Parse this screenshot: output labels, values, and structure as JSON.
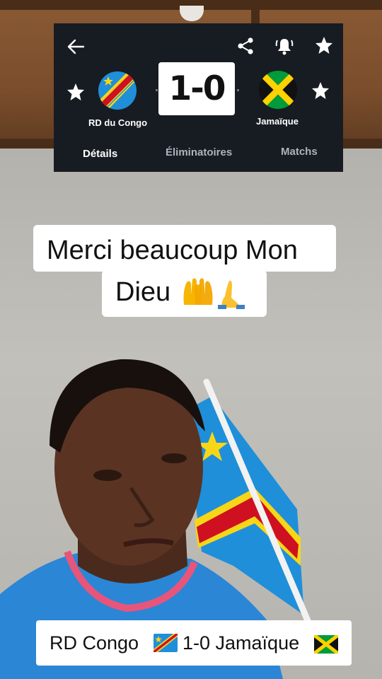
{
  "score_widget": {
    "home_team": "RD du Congo",
    "away_team": "Jamaïque",
    "score": "1-0",
    "tabs": [
      "Détails",
      "Éliminatoires",
      "Matchs"
    ],
    "active_tab": "Détails",
    "icons": [
      "back-arrow-icon",
      "share-icon",
      "bell-alert-icon",
      "star-icon"
    ]
  },
  "captions": {
    "line1": "Merci beaucoup Mon",
    "line2": "Dieu",
    "line2_emojis": [
      "open-hands-emoji",
      "folded-hands-emoji"
    ],
    "bottom_home": "RD Congo",
    "bottom_score_away": "1-0 Jamaïque"
  },
  "colors": {
    "widget_bg": "#171c22",
    "drc_blue": "#1f8fd9",
    "drc_red": "#ce1021",
    "drc_yellow": "#f7d618",
    "jam_green": "#009b3a",
    "jam_gold": "#fed100"
  }
}
